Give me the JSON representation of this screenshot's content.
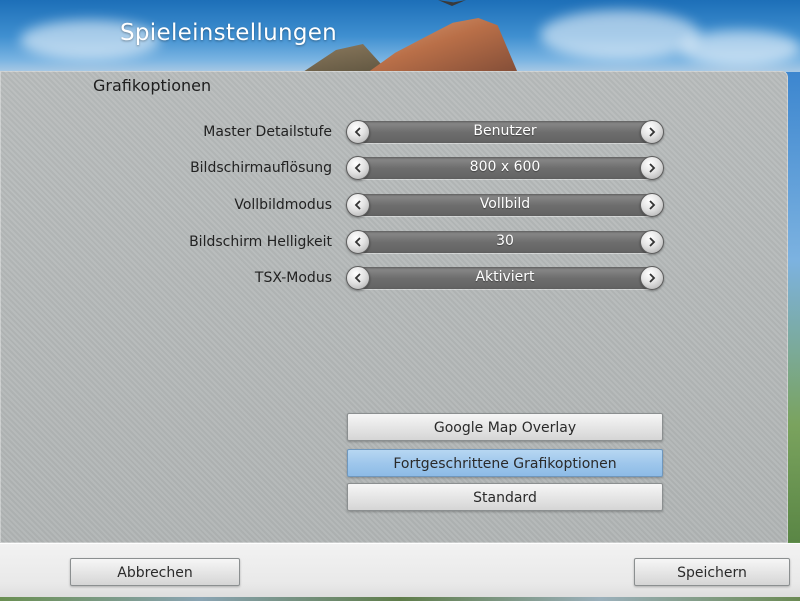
{
  "header": {
    "title": "Spieleinstellungen"
  },
  "panel": {
    "section_title": "Grafikoptionen",
    "settings": [
      {
        "label": "Master Detailstufe",
        "value": "Benutzer"
      },
      {
        "label": "Bildschirmauflösung",
        "value": "800 x 600"
      },
      {
        "label": "Vollbildmodus",
        "value": "Vollbild"
      },
      {
        "label": "Bildschirm Helligkeit",
        "value": "30"
      },
      {
        "label": "TSX-Modus",
        "value": "Aktiviert"
      }
    ],
    "buttons": {
      "google_map_overlay": "Google Map Overlay",
      "advanced_graphics": "Fortgeschrittene Grafikoptionen",
      "standard": "Standard"
    }
  },
  "footer": {
    "cancel": "Abbrechen",
    "save": "Speichern"
  },
  "colors": {
    "panel_bg": "#b6baba",
    "highlight_button": "#9fc7ec",
    "selector_track": "#727272"
  },
  "icons": {
    "prev": "chevron-left-icon",
    "next": "chevron-right-icon"
  }
}
